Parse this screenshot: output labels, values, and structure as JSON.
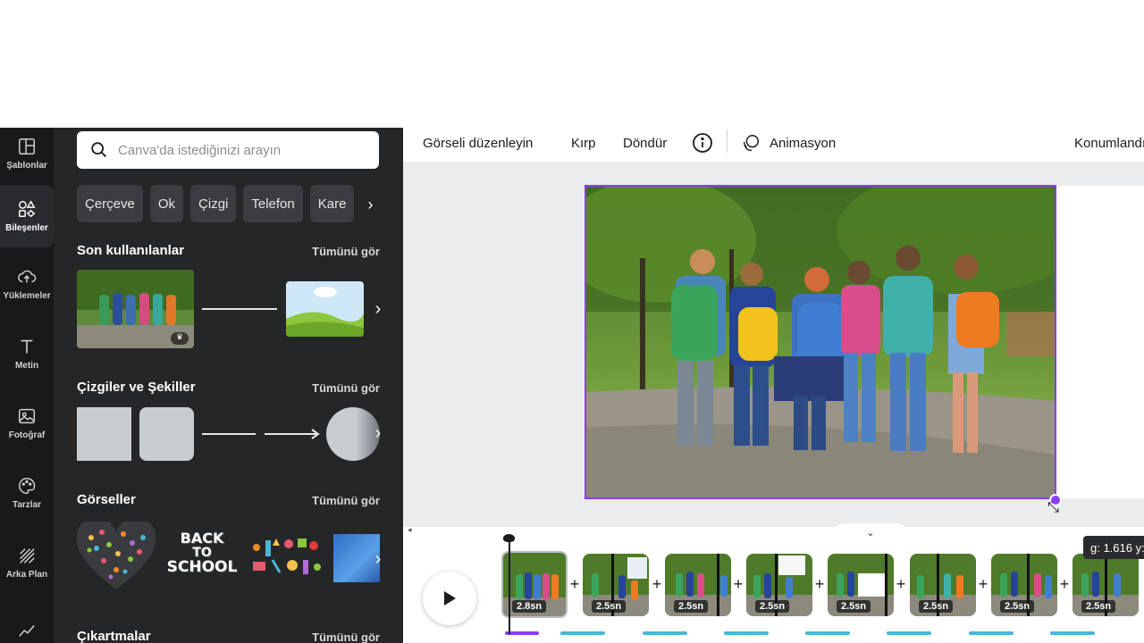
{
  "rail": {
    "items": [
      {
        "label": "Şablonlar",
        "icon": "layout-icon"
      },
      {
        "label": "Bileşenler",
        "icon": "elements-icon"
      },
      {
        "label": "Yüklemeler",
        "icon": "cloud-upload-icon"
      },
      {
        "label": "Metin",
        "icon": "text-icon"
      },
      {
        "label": "Fotoğraf",
        "icon": "image-icon"
      },
      {
        "label": "Tarzlar",
        "icon": "palette-icon"
      },
      {
        "label": "Arka Plan",
        "icon": "background-icon"
      },
      {
        "label": "",
        "icon": "chart-icon"
      }
    ]
  },
  "search": {
    "placeholder": "Canva'da istediğinizi arayın"
  },
  "chips": [
    "Çerçeve",
    "Ok",
    "Çizgi",
    "Telefon",
    "Kare"
  ],
  "sections": {
    "recent": {
      "title": "Son kullanılanlar",
      "see_all": "Tümünü gör"
    },
    "lines": {
      "title": "Çizgiler ve Şekiller",
      "see_all": "Tümünü gör"
    },
    "graphics": {
      "title": "Görseller",
      "see_all": "Tümünü gör"
    },
    "stickers": {
      "title": "Çıkartmalar",
      "see_all": "Tümünü gör"
    }
  },
  "back_to_school": {
    "line1": "BACK",
    "line2": "TO",
    "line3": "SCHOOL"
  },
  "toolbar": {
    "edit_image": "Görseli düzenleyin",
    "crop": "Kırp",
    "rotate": "Döndür",
    "animation": "Animasyon",
    "position": "Konumlandır"
  },
  "timeline": {
    "clips": [
      {
        "duration": "2.8sn",
        "selected": true
      },
      {
        "duration": "2.5sn",
        "selected": false
      },
      {
        "duration": "2.5sn",
        "selected": false
      },
      {
        "duration": "2.5sn",
        "selected": false
      },
      {
        "duration": "2.5sn",
        "selected": false
      },
      {
        "duration": "2.5sn",
        "selected": false
      },
      {
        "duration": "2.5sn",
        "selected": false
      },
      {
        "duration": "2.5sn",
        "selected": false
      }
    ],
    "tooltip": "g: 1.616 y:"
  },
  "colors": {
    "accent": "#8b3dff",
    "panel": "#252627",
    "rail": "#18191b",
    "timeline_bar": "#4ab6d9"
  }
}
